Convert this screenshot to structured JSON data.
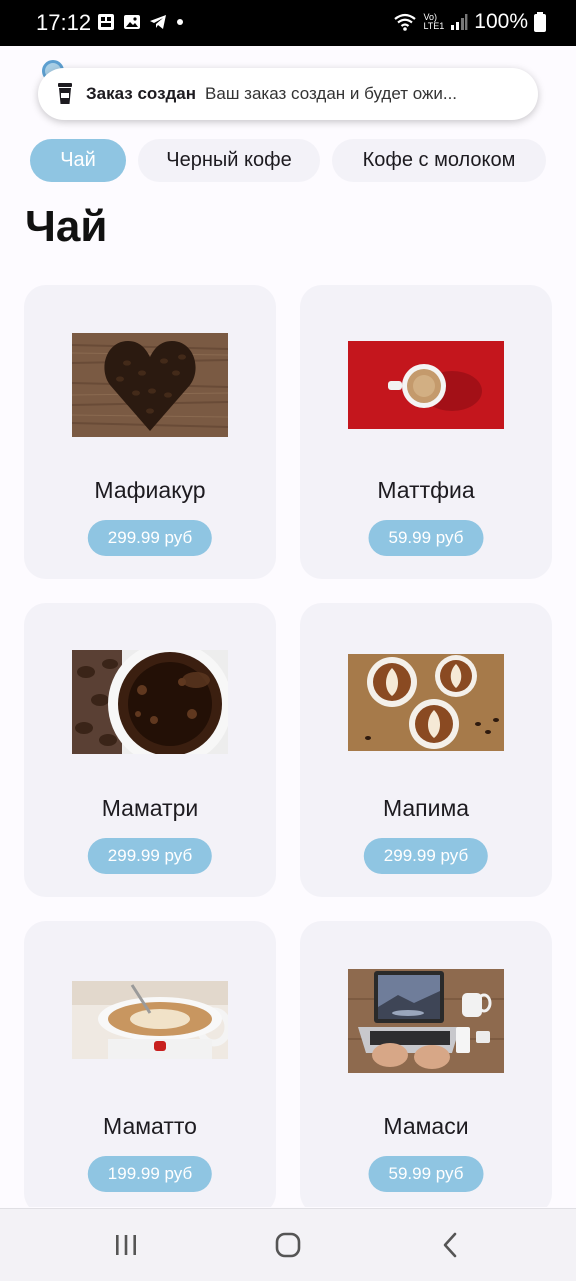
{
  "status": {
    "time": "17:12",
    "battery": "100%",
    "net_label_top": "Vo)",
    "net_label_bottom": "LTE1"
  },
  "toast": {
    "title": "Заказ создан",
    "message": "Ваш заказ создан и будет ожи..."
  },
  "tabs": [
    {
      "label": "Чай",
      "active": true
    },
    {
      "label": "Черный кофе",
      "active": false
    },
    {
      "label": "Кофе с молоком",
      "active": false
    }
  ],
  "heading": "Чай",
  "products": [
    {
      "name": "Мафиакур",
      "price": "299.99 руб",
      "image": "coffee-bean-heart-image"
    },
    {
      "name": "Маттфиа",
      "price": "59.99 руб",
      "image": "coffee-cup-red-background-image"
    },
    {
      "name": "Маматри",
      "price": "299.99 руб",
      "image": "black-coffee-closeup-image"
    },
    {
      "name": "Мапима",
      "price": "299.99 руб",
      "image": "latte-art-cups-image"
    },
    {
      "name": "Маматто",
      "price": "199.99 руб",
      "image": "cappuccino-spoon-image"
    },
    {
      "name": "Мамаси",
      "price": "59.99 руб",
      "image": "laptop-desk-image"
    }
  ],
  "colors": {
    "accent": "#8fc5e2",
    "card": "#f3f2f8",
    "background": "#fdfbff"
  }
}
